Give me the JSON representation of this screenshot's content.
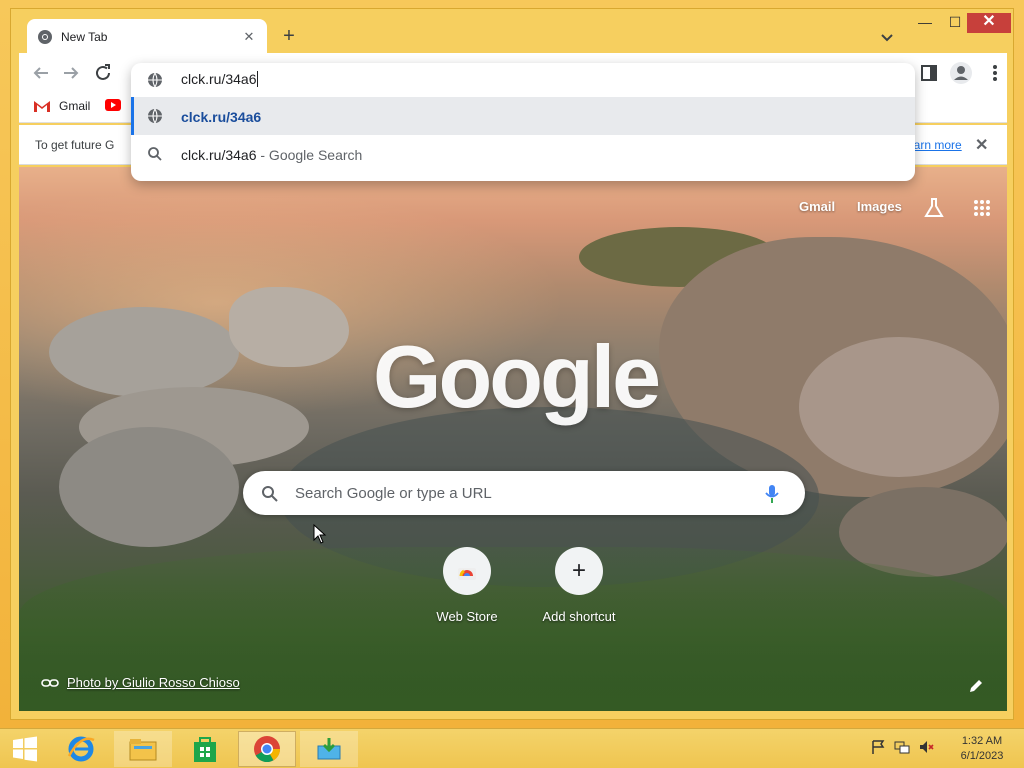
{
  "browser": {
    "tab": {
      "title": "New Tab",
      "close_glyph": "✕"
    },
    "new_tab_glyph": "+",
    "window_controls": {
      "minimize": "—",
      "maximize": "☐",
      "close": "✕"
    }
  },
  "bookmarks": [
    {
      "label": "Gmail",
      "icon": "gmail-icon"
    },
    {
      "label": "",
      "icon": "youtube-icon"
    }
  ],
  "infobar": {
    "text": "To get future G",
    "link": "earn more",
    "close_glyph": "✕"
  },
  "omnibox": {
    "input_value": "clck.ru/34a6",
    "suggestions": [
      {
        "text": "clck.ru/34a6",
        "sub": "",
        "icon": "globe-icon"
      },
      {
        "text": "clck.ru/34a6",
        "sub": " - Google Search",
        "icon": "search-icon"
      }
    ]
  },
  "ntp": {
    "gmail_link": "Gmail",
    "images_link": "Images",
    "logo_text": "Google",
    "search_placeholder": "Search Google or type a URL",
    "shortcuts": [
      {
        "label": "Web Store",
        "icon": "webstore-icon"
      },
      {
        "label": "Add shortcut",
        "icon": "plus-icon",
        "glyph": "+"
      }
    ],
    "photo_credit": "Photo by Giulio Rosso Chioso"
  },
  "taskbar": {
    "clock_time": "1:32 AM",
    "clock_date": "6/1/2023",
    "apps": [
      "start-icon",
      "internet-explorer-icon",
      "file-explorer-icon",
      "store-icon",
      "chrome-icon",
      "downloader-icon"
    ]
  },
  "colors": {
    "accent_blue": "#1a73e8",
    "suggestion_selected_bg": "#e8eaed",
    "window_frame": "#f6cf5f",
    "close_red": "#c7403b"
  }
}
